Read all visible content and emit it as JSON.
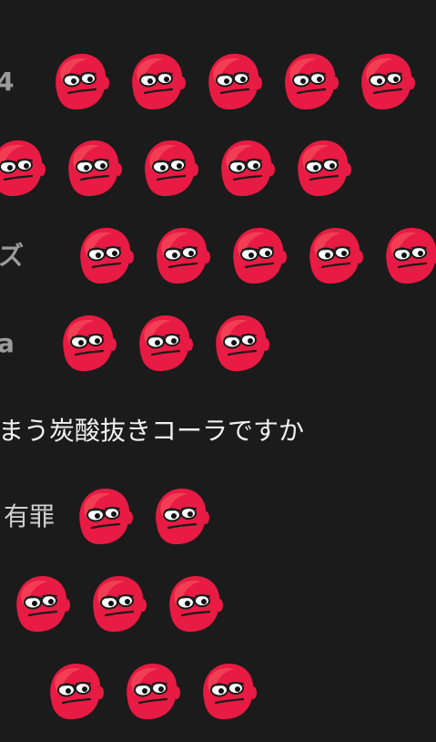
{
  "theme": {
    "background": "#1b1b1b",
    "text": "#f0f0f0",
    "dim_text": "#9b9b9b",
    "emoji_primary": "#e71b43",
    "emoji_highlight": "#ff6b6b"
  },
  "emote": {
    "name": "red-face-emote-icon"
  },
  "messages": [
    {
      "id": "line-1",
      "prefix": "4",
      "emoji_count": 5
    },
    {
      "id": "line-2",
      "prefix": "",
      "emoji_count": 5
    },
    {
      "id": "line-3",
      "prefix": "ズ",
      "emoji_count": 5
    },
    {
      "id": "line-4",
      "prefix": "a",
      "emoji_count": 3
    },
    {
      "id": "line-5",
      "text": "まう炭酸抜きコーラですか"
    },
    {
      "id": "line-6",
      "prefix": "有罪",
      "emoji_count": 2
    },
    {
      "id": "line-7",
      "prefix": "",
      "emoji_count": 3
    },
    {
      "id": "line-8",
      "prefix": "",
      "emoji_count": 3
    }
  ]
}
